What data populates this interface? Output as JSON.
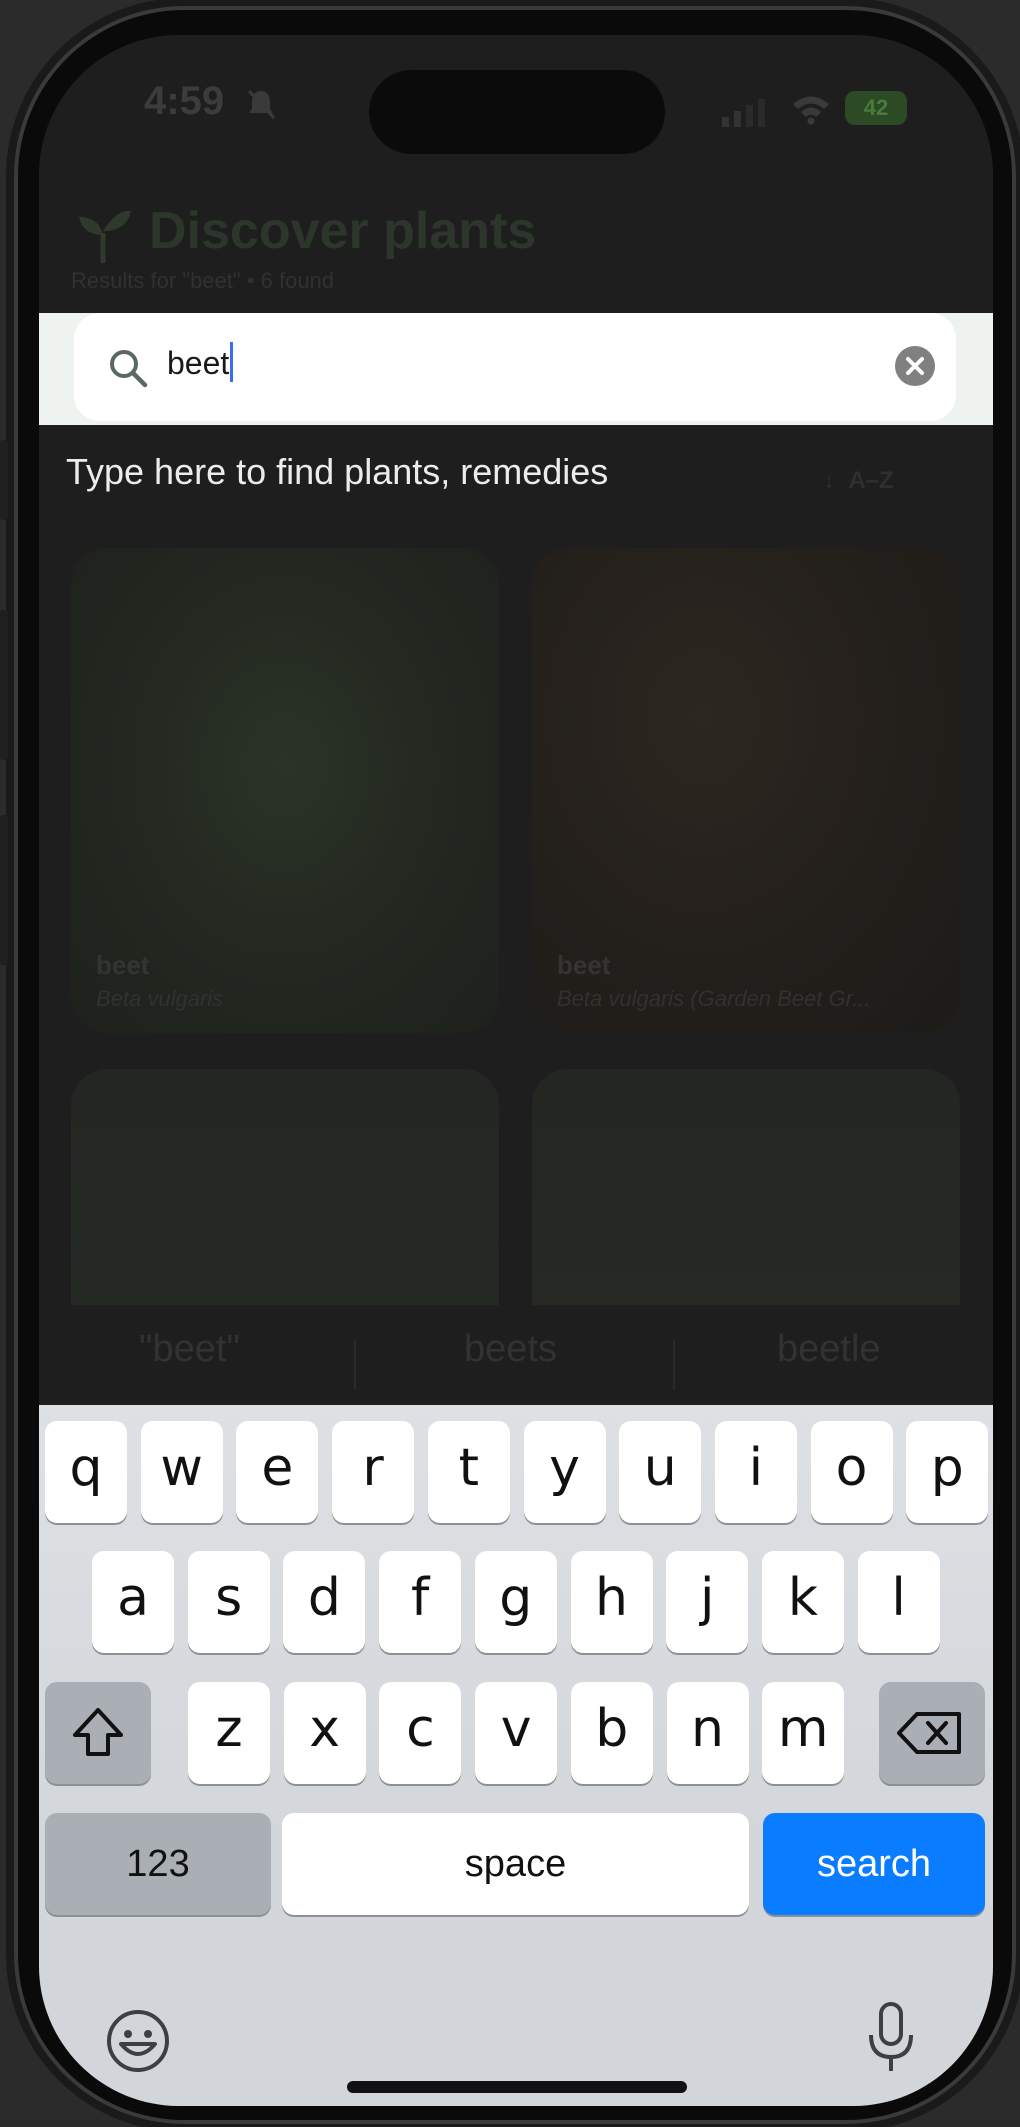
{
  "status_bar": {
    "time": "4:59",
    "battery": "42"
  },
  "header": {
    "title": "Discover plants",
    "subtitle": "Results for \"beet\" • 6 found"
  },
  "search": {
    "value": "beet"
  },
  "hint": "Type here to find plants, remedies",
  "sort": {
    "label": "A–Z"
  },
  "cards": [
    {
      "title": "beet",
      "subtitle": "Beta vulgaris"
    },
    {
      "title": "beet",
      "subtitle": "Beta vulgaris (Garden Beet Gr..."
    }
  ],
  "predictions": [
    "\"beet\"",
    "beets",
    "beetle"
  ],
  "keyboard": {
    "row1": [
      "q",
      "w",
      "e",
      "r",
      "t",
      "y",
      "u",
      "i",
      "o",
      "p"
    ],
    "row2": [
      "a",
      "s",
      "d",
      "f",
      "g",
      "h",
      "j",
      "k",
      "l"
    ],
    "row3": [
      "z",
      "x",
      "c",
      "v",
      "b",
      "n",
      "m"
    ],
    "numbers_label": "123",
    "space_label": "space",
    "search_label": "search"
  },
  "colors": {
    "accent": "#0a7cff",
    "caret": "#3b6cf0"
  }
}
